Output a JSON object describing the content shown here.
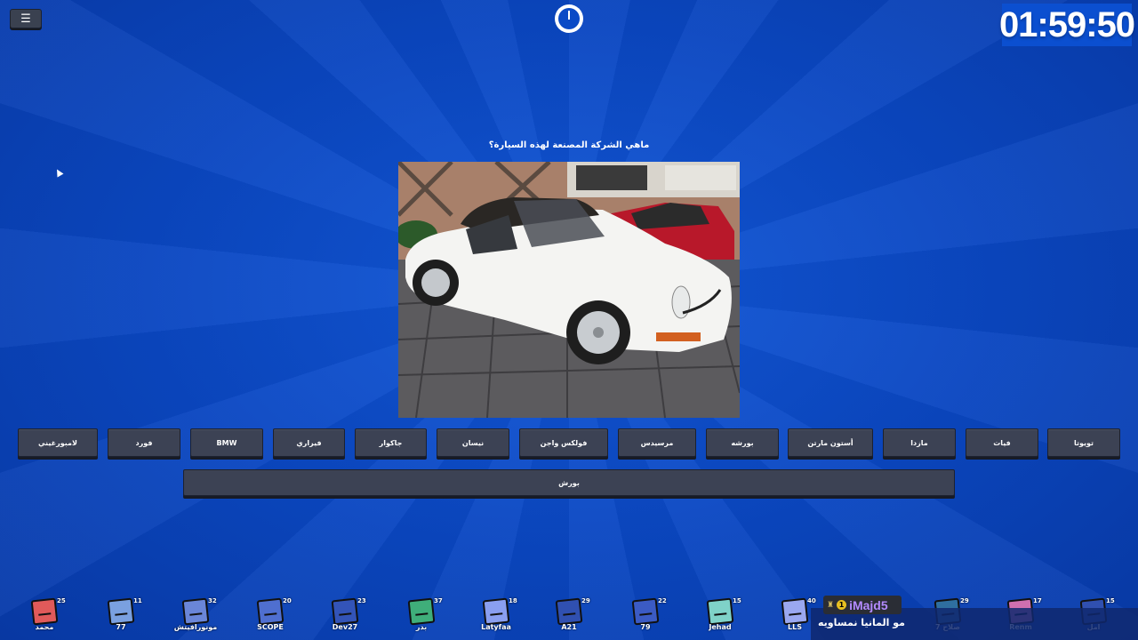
{
  "hud": {
    "menu_icon": "hamburger-menu-icon",
    "menu_glyph": "☰",
    "timer_icon": "stopwatch-icon",
    "clock": "01:59:50",
    "corner_small": "29"
  },
  "question": {
    "text": "ماهي الشركة المصنعة لهذه السيارة؟"
  },
  "options": [
    {
      "label": "لامبورغيني"
    },
    {
      "label": "فورد"
    },
    {
      "label": "BMW"
    },
    {
      "label": "فيراري"
    },
    {
      "label": "جاكوار"
    },
    {
      "label": "نيسان"
    },
    {
      "label": "فولكس واجن"
    },
    {
      "label": "مرسيدس"
    },
    {
      "label": "بورشه"
    },
    {
      "label": "أستون مارتن"
    },
    {
      "label": "مازدا"
    },
    {
      "label": "فيات"
    },
    {
      "label": "تويوتا"
    }
  ],
  "answer_display": {
    "text": "بورش"
  },
  "players": [
    {
      "name": "محمد",
      "score": "25",
      "color": "#e05a5a"
    },
    {
      "name": "77",
      "score": "11",
      "color": "#7aa0e0"
    },
    {
      "name": "مونورافيتش",
      "score": "32",
      "color": "#6a86d8"
    },
    {
      "name": "SCOPE",
      "score": "20",
      "color": "#4f6fd0"
    },
    {
      "name": "Dev27",
      "score": "23",
      "color": "#3354b8"
    },
    {
      "name": "بدر",
      "score": "37",
      "color": "#3fae7a"
    },
    {
      "name": "Latyfaa",
      "score": "18",
      "color": "#8a9ff0"
    },
    {
      "name": "A21",
      "score": "29",
      "color": "#3050b0"
    },
    {
      "name": "79",
      "score": "22",
      "color": "#3b5bc4"
    },
    {
      "name": "Jehad",
      "score": "15",
      "color": "#7fd2c8"
    },
    {
      "name": "LLS",
      "score": "40",
      "color": "#9aa8f0"
    },
    {
      "name": "صلاح 7",
      "score": "29",
      "color": "#2f6fa0"
    },
    {
      "name": "Renm",
      "score": "17",
      "color": "#d070b0"
    },
    {
      "name": "امل",
      "score": "15",
      "color": "#3050b0"
    }
  ],
  "chat": {
    "username": "iMajd5",
    "badge": "1",
    "rank_icon": "trophy-icon",
    "rank_glyph": "♜",
    "message": "مو المانيا نمساويه"
  }
}
